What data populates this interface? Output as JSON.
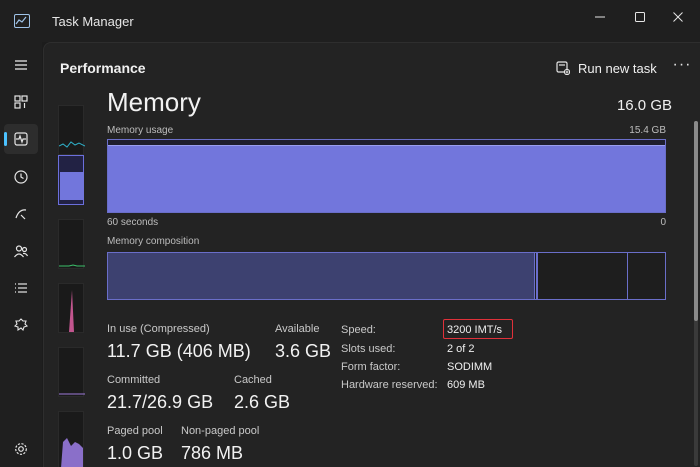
{
  "window": {
    "title": "Task Manager"
  },
  "header": {
    "page_title": "Performance",
    "run_new_task": "Run new task",
    "more": "···"
  },
  "memory": {
    "title": "Memory",
    "total": "16.0 GB",
    "usage_label": "Memory usage",
    "usage_max": "15.4 GB",
    "usage_fraction": 0.93,
    "time_left": "60 seconds",
    "time_right": "0",
    "composition_label": "Memory composition",
    "stats": {
      "in_use_label": "In use (Compressed)",
      "in_use_value": "11.7 GB (406 MB)",
      "available_label": "Available",
      "available_value": "3.6 GB",
      "committed_label": "Committed",
      "committed_value": "21.7/26.9 GB",
      "cached_label": "Cached",
      "cached_value": "2.6 GB",
      "paged_pool_label": "Paged pool",
      "paged_pool_value": "1.0 GB",
      "non_paged_pool_label": "Non-paged pool",
      "non_paged_pool_value": "786 MB"
    },
    "details": {
      "speed_label": "Speed:",
      "speed_value": "3200 IMT/s",
      "slots_label": "Slots used:",
      "slots_value": "2 of 2",
      "form_factor_label": "Form factor:",
      "form_factor_value": "SODIMM",
      "hw_reserved_label": "Hardware reserved:",
      "hw_reserved_value": "609 MB"
    }
  },
  "colors": {
    "accent": "#4cc2ff",
    "memory_fill": "#7276dc",
    "memory_line": "#6a6ec9",
    "highlight": "#e0313a"
  },
  "nav": [
    "hamburger-icon",
    "processes-icon",
    "performance-icon",
    "app-history-icon",
    "startup-apps-icon",
    "users-icon",
    "details-icon",
    "services-icon",
    "settings-icon"
  ]
}
